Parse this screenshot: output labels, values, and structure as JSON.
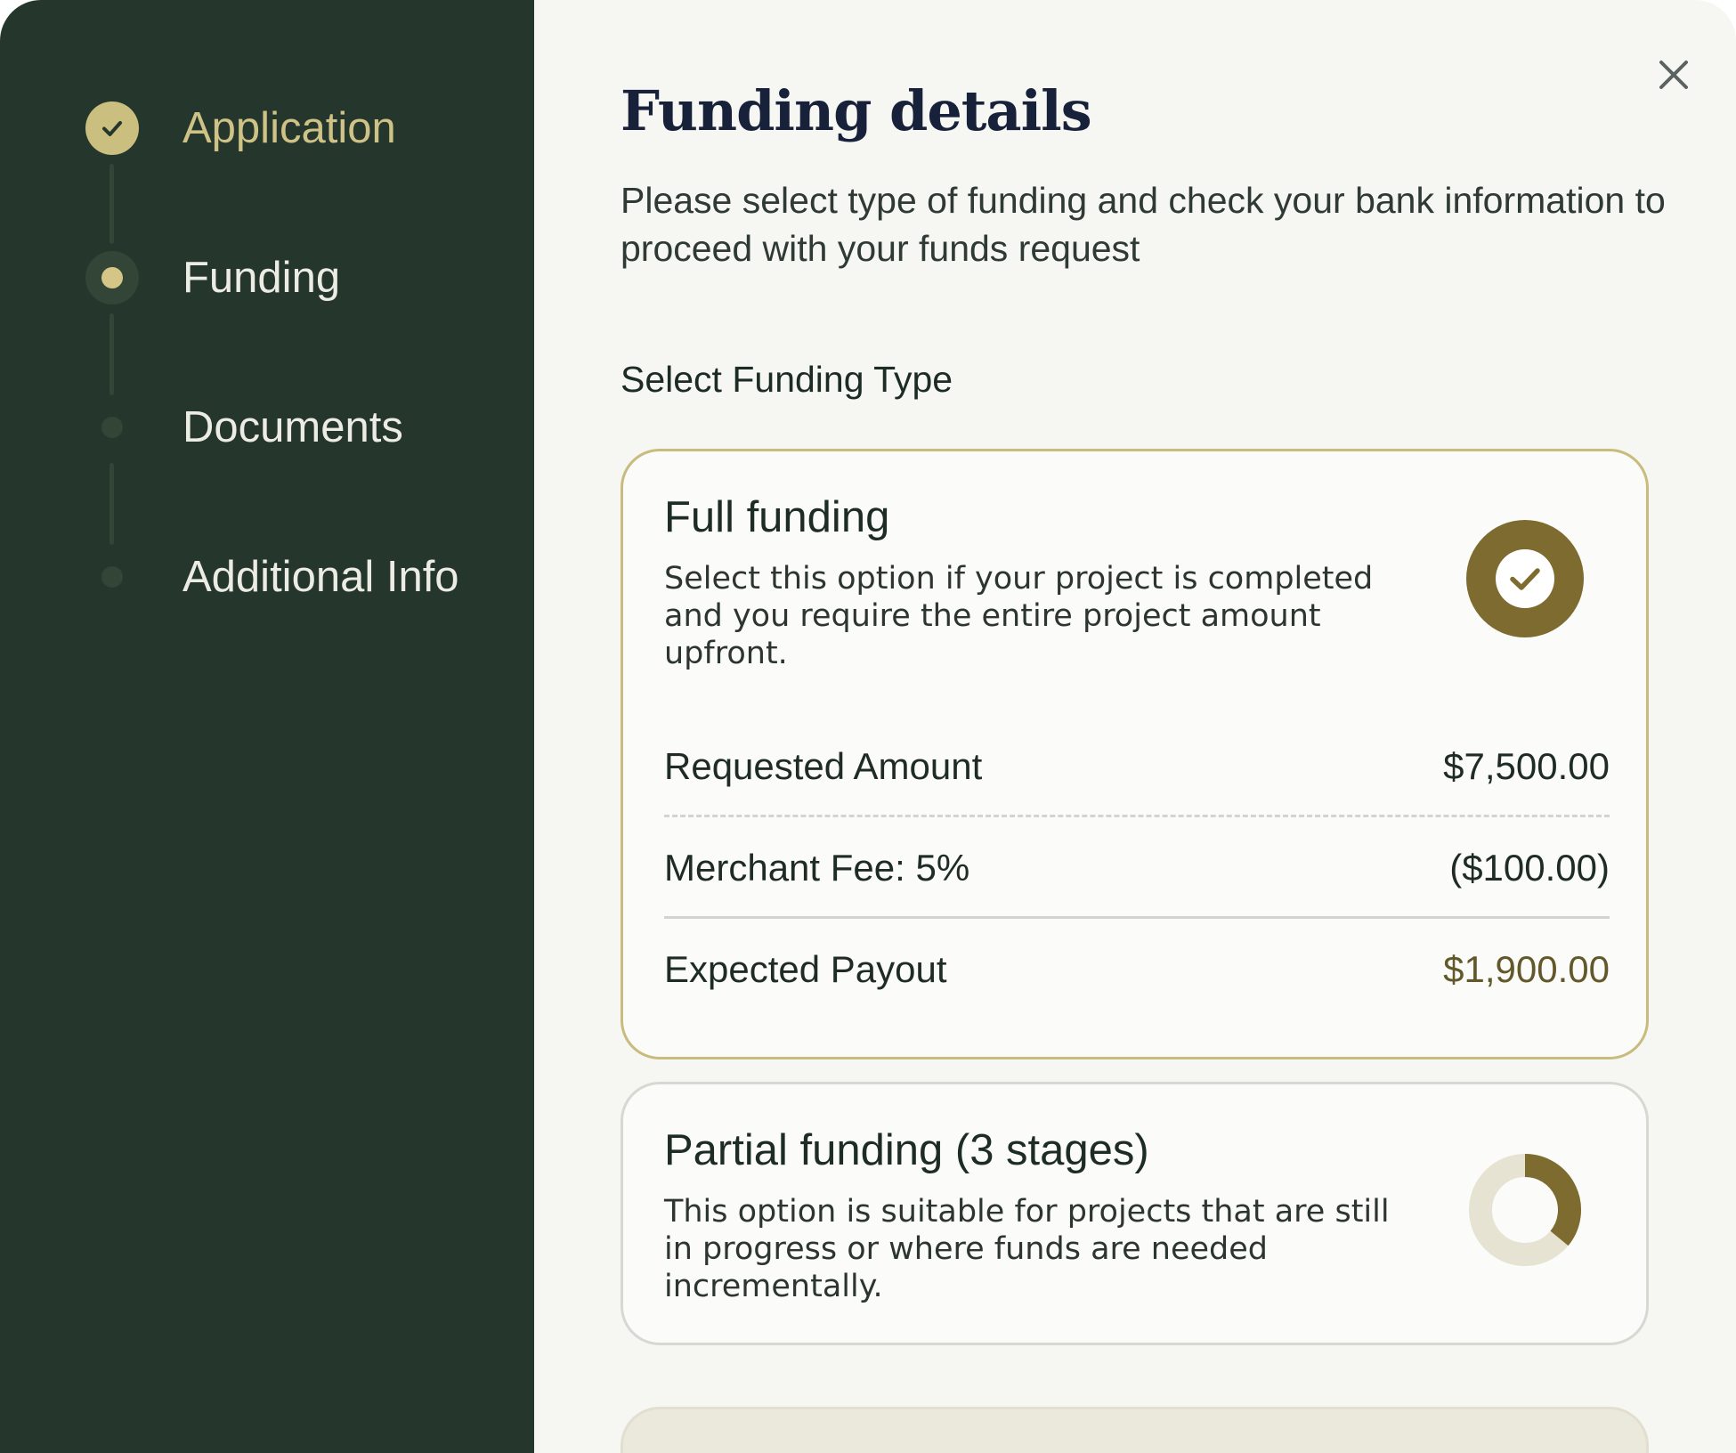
{
  "sidebar": {
    "steps": [
      {
        "label": "Application",
        "status": "done"
      },
      {
        "label": "Funding",
        "status": "current"
      },
      {
        "label": "Documents",
        "status": "todo"
      },
      {
        "label": "Additional Info",
        "status": "todo"
      }
    ]
  },
  "header": {
    "title": "Funding details",
    "subtitle": "Please select type of funding and check your bank information to proceed with your funds request",
    "close_icon": "close-icon"
  },
  "section_label": "Select Funding Type",
  "options": {
    "full": {
      "title": "Full funding",
      "description": "Select this option if your project is completed and you require the entire  project amount upfront.",
      "selected": true,
      "icon": "check-circle-icon",
      "rows": {
        "requested_label": "Requested Amount",
        "requested_value": "$7,500.00",
        "fee_label": "Merchant Fee: 5%",
        "fee_value": "($100.00)",
        "payout_label": "Expected Payout",
        "payout_value": "$1,900.00"
      }
    },
    "partial": {
      "title": "Partial funding (3 stages)",
      "description": "This option is suitable for projects that are still in progress or where funds are needed incrementally.",
      "selected": false,
      "icon": "progress-ring-icon",
      "progress_fraction": 0.36
    }
  },
  "colors": {
    "sidebar_bg": "#25372c",
    "accent_gold": "#cbbf7f",
    "accent_olive": "#7e6b2f",
    "title_navy": "#18213a"
  }
}
